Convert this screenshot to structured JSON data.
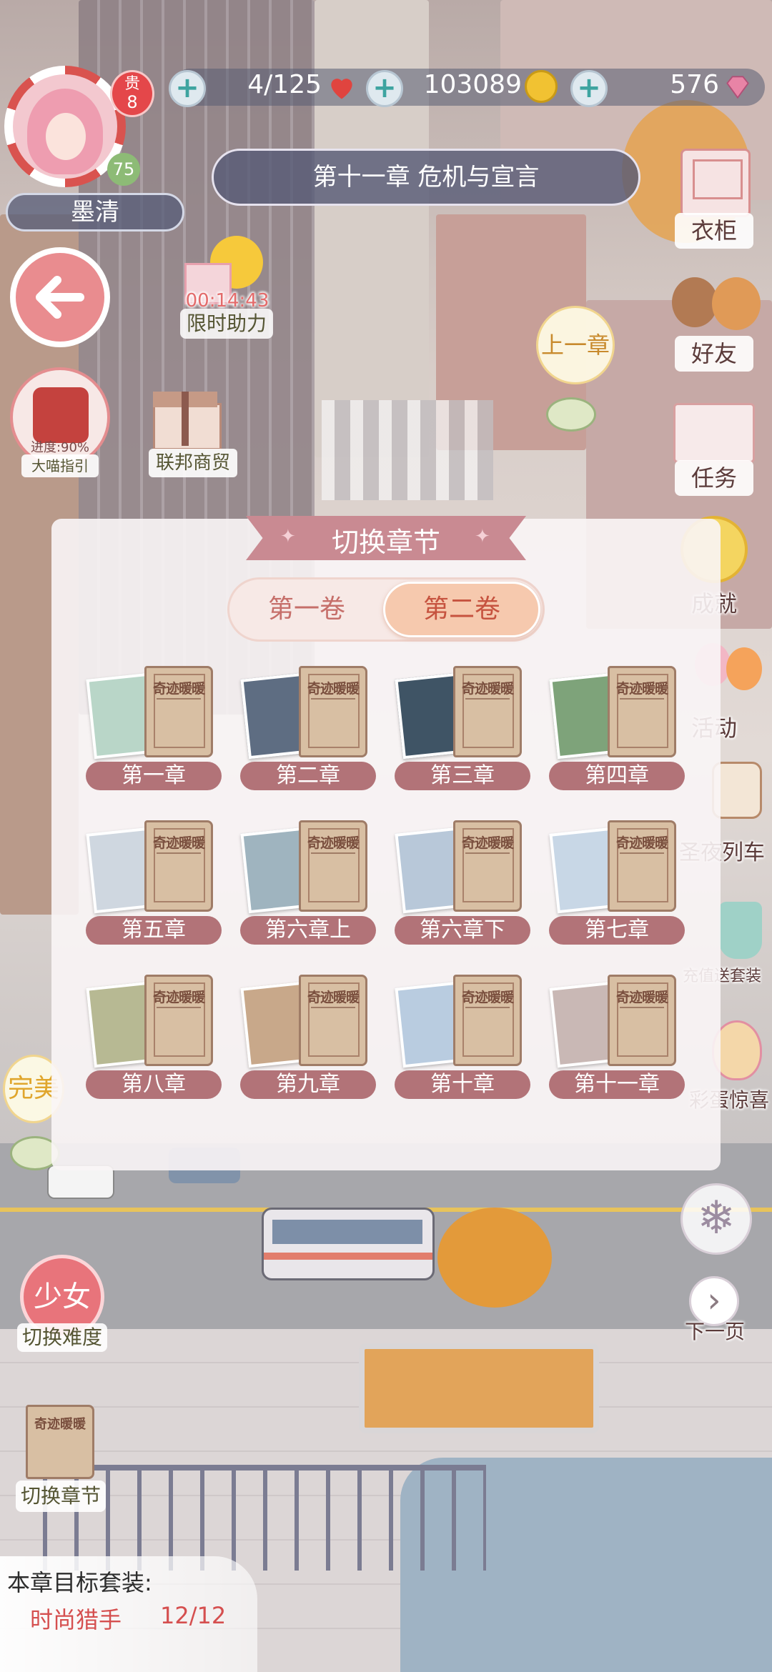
{
  "header": {
    "vip_label": "贵",
    "vip_level": "8",
    "player_level": "75",
    "player_name": "墨清",
    "stamina": "4/125",
    "coins": "103089",
    "diamonds": "576",
    "chapter_title": "第十一章 危机与宣言"
  },
  "left_menu": {
    "timer": "00:14:43",
    "boost_label": "限时助力",
    "guide_progress": "进度:90%",
    "guide_label": "大喵指引",
    "trade_label": "联邦商贸",
    "difficulty_badge": "少女",
    "difficulty_label": "切换难度",
    "switch_chapter_label": "切换章节"
  },
  "right_menu": {
    "wardrobe": "衣柜",
    "friends": "好友",
    "tasks": "任务",
    "achievements": "成就",
    "events": "活动",
    "train": "圣夜列车",
    "recharge": "充值送套装",
    "surprise": "彩蛋惊喜",
    "next_page": "下一页"
  },
  "map": {
    "prev_chapter": "上一章",
    "node_perfect": "完美"
  },
  "panel": {
    "title": "切换章节",
    "volume_tabs": [
      "第一卷",
      "第二卷"
    ],
    "active_volume": 1,
    "book_title": "奇迹暖暖",
    "chapters": [
      "第一章",
      "第二章",
      "第三章",
      "第四章",
      "第五章",
      "第六章上",
      "第六章下",
      "第七章",
      "第八章",
      "第九章",
      "第十章",
      "第十一章"
    ]
  },
  "goal": {
    "heading": "本章目标套装:",
    "suit_name": "时尚猎手",
    "progress": "12/12"
  },
  "colors": {
    "accent_pink": "#d9707a",
    "label_rose": "#b27378",
    "cyan_plus": "#3ea4a0",
    "tab_active": "#f6c9ae",
    "title_ribbon": "#c98a92"
  }
}
